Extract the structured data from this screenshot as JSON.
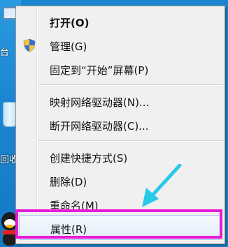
{
  "desktop": {
    "label_fragment_1": "台",
    "label_fragment_2": "回收"
  },
  "menu": {
    "items": [
      {
        "label": "打开(O)",
        "bold": true
      },
      {
        "label": "管理(G)",
        "icon": "uac-shield-icon"
      },
      {
        "label": "固定到“开始”屏幕(P)"
      },
      {
        "label": "映射网络驱动器(N)..."
      },
      {
        "label": "断开网络驱动器(C)..."
      },
      {
        "label": "创建快捷方式(S)"
      },
      {
        "label": "删除(D)"
      },
      {
        "label": "重命名(M)"
      },
      {
        "label": "属性(R)",
        "highlighted": true
      }
    ]
  },
  "annotation": {
    "arrow_color": "#27c9e8",
    "box_color": "#e81bd8"
  }
}
